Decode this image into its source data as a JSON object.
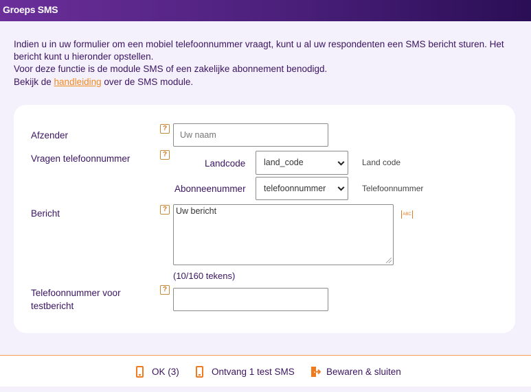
{
  "window": {
    "title": "Groeps SMS"
  },
  "intro": {
    "line1": "Indien u in uw formulier om een mobiel telefoonnummer vraagt, kunt u al uw respondenten een SMS bericht sturen. Het bericht kunt u hieronder opstellen.",
    "line2": "Voor deze functie is de module SMS of een zakelijke abonnement benodigd.",
    "line3_prefix": "Bekijk de ",
    "line3_link": "handleiding",
    "line3_suffix": " over de SMS module."
  },
  "form": {
    "help_glyph": "?",
    "sender": {
      "label": "Afzender",
      "placeholder": "Uw naam"
    },
    "ask_phone": {
      "label": "Vragen telefoonnummer",
      "country_code": {
        "label": "Landcode",
        "selected": "land_code",
        "hint": "Land code"
      },
      "subscriber": {
        "label": "Abonneenummer",
        "selected": "telefoonnummer",
        "hint": "Telefoonnummer"
      }
    },
    "message": {
      "label": "Bericht",
      "value": "Uw bericht",
      "counter": "(10/160 tekens)",
      "spell_icon_text": "ABC"
    },
    "test_phone": {
      "label_line1": "Telefoonnummer voor",
      "label_line2": "testbericht",
      "value": ""
    }
  },
  "footer": {
    "ok_label": "OK (3)",
    "test_label": "Ontvang 1 test SMS",
    "save_label": "Bewaren & sluiten"
  },
  "colors": {
    "accent": "#f08a1e",
    "text": "#3a1460",
    "title_bg": "#4a1f7a"
  }
}
